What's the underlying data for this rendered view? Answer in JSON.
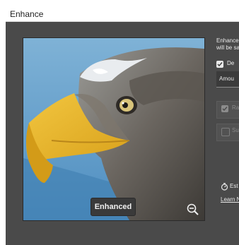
{
  "window": {
    "title": "Enhance"
  },
  "preview": {
    "badge_label": "Enhanced",
    "zoom_icon": "zoom-out-icon"
  },
  "right_panel": {
    "intro_line1": "Enhance",
    "intro_line2": "will be sa",
    "denoise": {
      "label": "De",
      "checked": true
    },
    "amount_dropdown": {
      "label": "Amou"
    },
    "option_two": {
      "label": "Ra",
      "checked": true,
      "disabled": true
    },
    "option_three": {
      "label": "Su",
      "checked": false,
      "disabled": true
    },
    "estimate": {
      "label": "Est",
      "icon": "stopwatch-icon"
    },
    "learn_more": "Learn N"
  }
}
